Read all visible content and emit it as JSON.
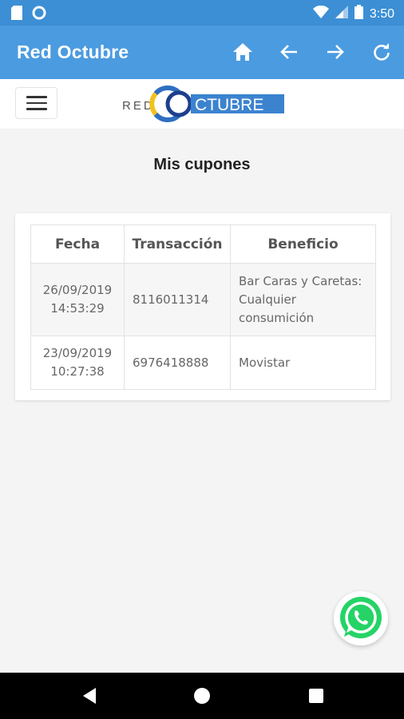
{
  "status_bar": {
    "time": "3:50",
    "icons": [
      "sd-card-icon",
      "circle-notification-icon",
      "wifi-icon",
      "signal-icon",
      "battery-icon"
    ]
  },
  "app_bar": {
    "title": "Red Octubre",
    "actions": [
      "home-icon",
      "back-arrow-icon",
      "forward-arrow-icon",
      "refresh-icon"
    ]
  },
  "site_header": {
    "logo": {
      "part1": "RED",
      "part2": "CTUBRE"
    }
  },
  "page": {
    "heading": "Mis cupones",
    "table": {
      "headers": [
        "Fecha",
        "Transacción",
        "Beneficio"
      ],
      "rows": [
        {
          "fecha_date": "26/09/2019",
          "fecha_time": "14:53:29",
          "transaccion": "8116011314",
          "beneficio": [
            "Bar Caras y Caretas:",
            "Cualquier",
            "consumición"
          ]
        },
        {
          "fecha_date": "23/09/2019",
          "fecha_time": "10:27:38",
          "transaccion": "6976418888",
          "beneficio": [
            "Movistar"
          ]
        }
      ]
    }
  },
  "floating": {
    "icon": "whatsapp-icon"
  },
  "system_nav": [
    "back-triangle-icon",
    "home-circle-icon",
    "recents-square-icon"
  ],
  "colors": {
    "status_bar": "#3c8fd5",
    "app_bar": "#4b9be0",
    "logo_blue": "#2e6fc0",
    "logo_yellow": "#f2c31b",
    "whatsapp_green": "#25d366"
  }
}
